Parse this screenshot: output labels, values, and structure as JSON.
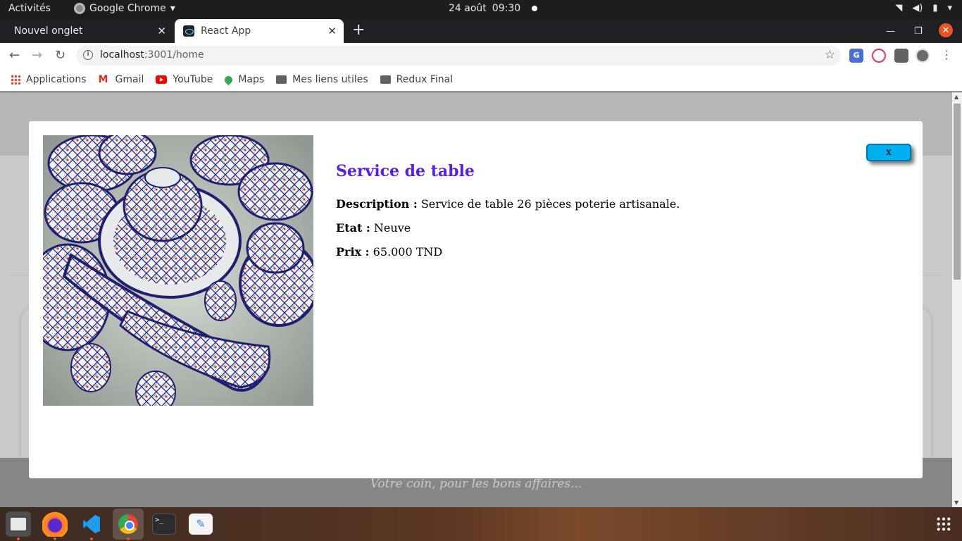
{
  "topbar": {
    "activities": "Activités",
    "app_name": "Google Chrome",
    "date": "24 août",
    "time": "09:30"
  },
  "tabs": [
    {
      "title": "Nouvel onglet",
      "active": false
    },
    {
      "title": "React App",
      "active": true
    }
  ],
  "address": {
    "host": "localhost",
    "path": ":3001/home"
  },
  "bookmarks": [
    {
      "label": "Applications",
      "icon": "apps-grid-icon"
    },
    {
      "label": "Gmail",
      "icon": "gmail-icon"
    },
    {
      "label": "YouTube",
      "icon": "youtube-icon"
    },
    {
      "label": "Maps",
      "icon": "maps-icon"
    },
    {
      "label": "Mes liens utiles",
      "icon": "folder-icon"
    },
    {
      "label": "Redux Final",
      "icon": "folder-icon"
    }
  ],
  "modal": {
    "close_label": "x",
    "product_title": "Service de table",
    "description_label": "Description :",
    "description_value": "Service de table 26 pièces poterie artisanale.",
    "etat_label": "Etat :",
    "etat_value": "Neuve",
    "prix_label": "Prix :",
    "prix_value": "65.000 TND"
  },
  "page": {
    "footer_text": "Votre coin, pour les bons affaires..."
  },
  "colors": {
    "title_purple": "#5b1cf0",
    "close_button": "#00b0f0",
    "ubuntu_orange": "#e95420"
  }
}
